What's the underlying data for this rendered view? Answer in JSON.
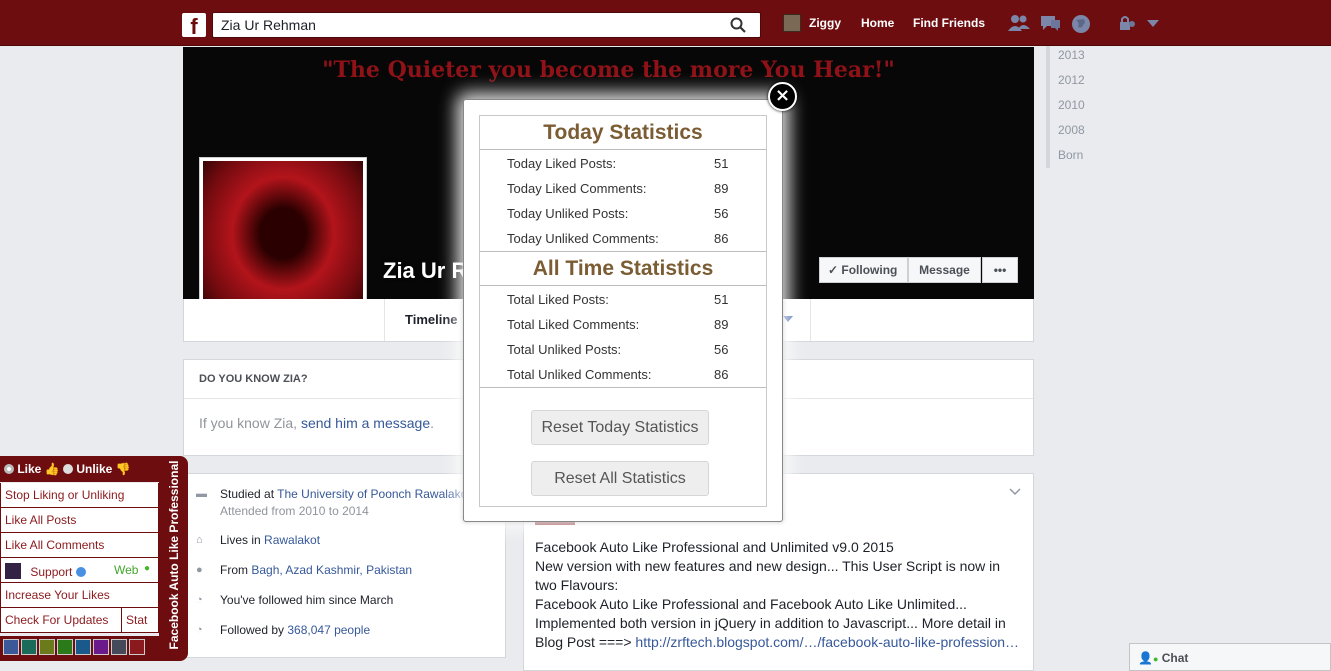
{
  "topbar": {
    "logo": "f",
    "search_value": "Zia Ur Rehman",
    "user": "Ziggy",
    "home": "Home",
    "find_friends": "Find Friends"
  },
  "cover": {
    "quote": "\"The Quieter you become the more You Hear!\"",
    "name": "Zia Ur R",
    "following": "Following",
    "message": "Message",
    "more": "•••"
  },
  "tabs": {
    "timeline": "Timeline"
  },
  "years": [
    "2013",
    "2012",
    "2010",
    "2008",
    "Born"
  ],
  "dyk": {
    "title": "DO YOU KNOW ZIA?",
    "prefix": "If you know Zia, ",
    "link": "send him a message",
    "suffix": "."
  },
  "about": {
    "studied_prefix": "Studied at ",
    "studied_link": "The University of Poonch Rawalakot",
    "studied_sub": "Attended from 2010 to 2014",
    "lives_prefix": "Lives in ",
    "lives_link": "Rawalakot",
    "from_prefix": "From ",
    "from_link": "Bagh, Azad Kashmir, Pakistan",
    "followed": "You've followed him since March",
    "followers_prefix": "Followed by ",
    "followers_link": "368,047 people"
  },
  "post": {
    "line1": "Facebook Auto Like Professional and Unlimited v9.0 2015",
    "line2": "New version with new features and new design... This User Script is now in two Flavours:",
    "line3": "Facebook Auto Like Professional and Facebook Auto Like Unlimited...",
    "line4": "Implemented both version in jQuery in addition to Javascript... More detail in Blog Post ===> ",
    "link": "http://zrftech.blogspot.com/…/facebook-auto-like-profession…"
  },
  "stats": {
    "today_title": "Today Statistics",
    "today": [
      {
        "label": "Today Liked Posts:",
        "value": "51"
      },
      {
        "label": "Today Liked Comments:",
        "value": "89"
      },
      {
        "label": "Today Unliked Posts:",
        "value": "56"
      },
      {
        "label": "Today Unliked Comments:",
        "value": "86"
      }
    ],
    "all_title": "All Time Statistics",
    "all": [
      {
        "label": "Total Liked Posts:",
        "value": "51"
      },
      {
        "label": "Total Liked Comments:",
        "value": "89"
      },
      {
        "label": "Total Unliked Posts:",
        "value": "56"
      },
      {
        "label": "Total Unliked Comments:",
        "value": "86"
      }
    ],
    "reset_today": "Reset Today Statistics",
    "reset_all": "Reset All Statistics",
    "close": "×"
  },
  "extension": {
    "like": "Like",
    "unlike": "Unlike",
    "stop": "Stop Liking or Unliking",
    "like_posts": "Like All Posts",
    "like_comments": "Like All Comments",
    "support": "Support",
    "web": "Web",
    "increase": "Increase Your Likes",
    "updates": "Check For Updates",
    "stat": "Stat",
    "side_title": "Facebook Auto Like Professional",
    "swatches": [
      "#3b5998",
      "#1a6b5a",
      "#6b7a1a",
      "#2a7a1a",
      "#1a5a8a",
      "#6a1a8a",
      "#444a5a",
      "#8b1a1e"
    ]
  },
  "chat": {
    "label": "Chat"
  }
}
